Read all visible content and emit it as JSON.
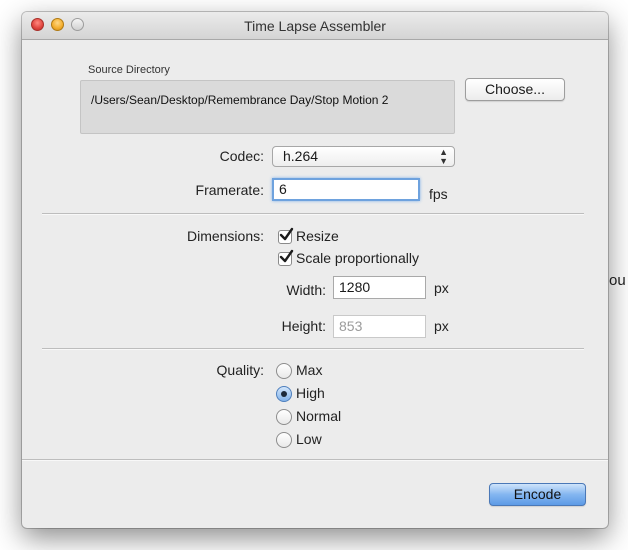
{
  "background": {
    "partial_text": "ou"
  },
  "window": {
    "title": "Time Lapse Assembler"
  },
  "source": {
    "label": "Source Directory",
    "path": "/Users/Sean/Desktop/Remembrance Day/Stop Motion 2",
    "choose_button": "Choose..."
  },
  "codec": {
    "label": "Codec:",
    "value": "h.264"
  },
  "framerate": {
    "label": "Framerate:",
    "value": "6",
    "unit": "fps"
  },
  "dimensions": {
    "label": "Dimensions:",
    "resize": {
      "label": "Resize",
      "checked": true
    },
    "scale": {
      "label": "Scale proportionally",
      "checked": true
    },
    "width": {
      "label": "Width:",
      "value": "1280",
      "unit": "px"
    },
    "height": {
      "label": "Height:",
      "value": "853",
      "unit": "px"
    }
  },
  "quality": {
    "label": "Quality:",
    "options": [
      {
        "label": "Max",
        "selected": false
      },
      {
        "label": "High",
        "selected": true
      },
      {
        "label": "Normal",
        "selected": false
      },
      {
        "label": "Low",
        "selected": false
      }
    ]
  },
  "encode_button": "Encode",
  "colors": {
    "accent": "#6ea2de",
    "encode_button": "#84b6f0",
    "window_bg": "#ececec"
  }
}
